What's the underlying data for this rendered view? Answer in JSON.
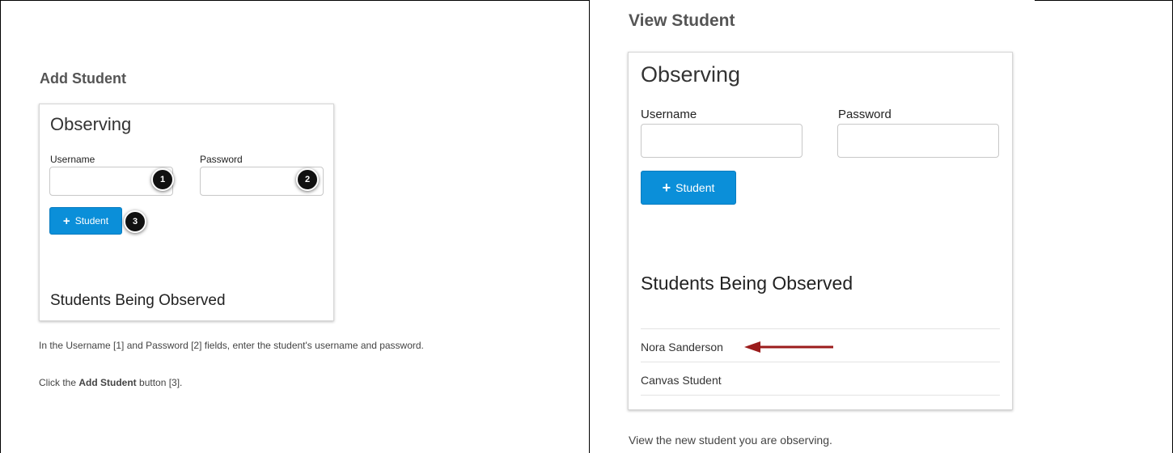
{
  "left_panel": {
    "title": "Add Student",
    "card": {
      "heading": "Observing",
      "username_label": "Username",
      "password_label": "Password",
      "username_value": "",
      "password_value": "",
      "add_button_label": "Student",
      "add_button_icon": "plus-icon",
      "observed_heading": "Students Being Observed"
    },
    "callouts": [
      "1",
      "2",
      "3"
    ],
    "instruction_1": "In the Username [1] and Password [2] fields, enter the student's username and password.",
    "instruction_2_prefix": "Click the ",
    "instruction_2_bold": "Add Student",
    "instruction_2_suffix": " button [3]."
  },
  "right_panel": {
    "title": "View Student",
    "card": {
      "heading": "Observing",
      "username_label": "Username",
      "password_label": "Password",
      "username_value": "",
      "password_value": "",
      "add_button_label": "Student",
      "add_button_icon": "plus-icon",
      "observed_heading": "Students Being Observed",
      "students": [
        "Nora Sanderson",
        "Canvas Student"
      ]
    },
    "caption": "View the new student you are observing."
  },
  "colors": {
    "button_blue": "#0b8fd9",
    "arrow_red": "#9b1c1c",
    "callout_black": "#111111"
  }
}
